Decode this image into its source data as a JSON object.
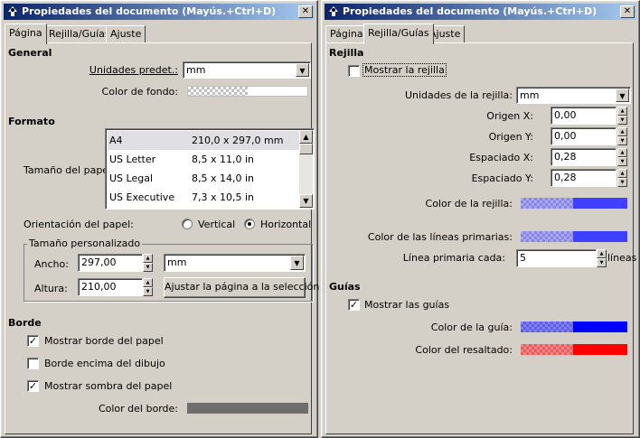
{
  "left": {
    "title": "Propiedades del documento (Mayús.+Ctrl+D)",
    "tabs": [
      "Página",
      "Rejilla/Guías",
      "Ajuste"
    ],
    "general": {
      "heading": "General",
      "units_label": "Unidades predet.:",
      "units_value": "mm",
      "bg_color_label": "Color de fondo:"
    },
    "format": {
      "heading": "Formato",
      "paper_size_label": "Tamaño del papel:",
      "paper_sizes": [
        {
          "name": "A4",
          "size": "210,0 x 297,0 mm"
        },
        {
          "name": "US Letter",
          "size": "8,5 x 11,0 in"
        },
        {
          "name": "US Legal",
          "size": "8,5 x 14,0 in"
        },
        {
          "name": "US Executive",
          "size": "7,3 x 10,5 in"
        }
      ],
      "orientation_label": "Orientación del papel:",
      "orientation_vertical": "Vertical",
      "orientation_horizontal": "Horizontal",
      "orientation_selected": "Horizontal",
      "custom_size_label": "Tamaño personalizado",
      "width_label": "Ancho:",
      "width_value": "297,00",
      "height_label": "Altura:",
      "height_value": "210,00",
      "custom_units": "mm",
      "fit_button": "Ajustar la página a la selección"
    },
    "border": {
      "heading": "Borde",
      "show_border": "Mostrar borde del papel",
      "show_border_checked": true,
      "border_on_top": "Borde encima del dibujo",
      "border_on_top_checked": false,
      "show_shadow": "Mostrar sombra del papel",
      "show_shadow_checked": true,
      "border_color_label": "Color del borde:"
    }
  },
  "right": {
    "title": "Propiedades del documento (Mayús.+Ctrl+D)",
    "tabs": [
      "Página",
      "Rejilla/Guías",
      "Ajuste"
    ],
    "grid": {
      "heading": "Rejilla",
      "show_grid": "Mostrar la rejilla",
      "show_grid_checked": false,
      "units_label": "Unidades de la rejilla:",
      "units_value": "mm",
      "origin_x_label": "Origen X:",
      "origin_x": "0,00",
      "origin_y_label": "Origen Y:",
      "origin_y": "0,00",
      "spacing_x_label": "Espaciado X:",
      "spacing_x": "0,28",
      "spacing_y_label": "Espaciado Y:",
      "spacing_y": "0,28",
      "grid_color_label": "Color de la rejilla:",
      "major_color_label": "Color de las líneas primarias:",
      "major_every_label": "Línea primaria cada:",
      "major_every_value": "5",
      "major_every_unit": "líneas"
    },
    "guides": {
      "heading": "Guías",
      "show_guides": "Mostrar las guías",
      "show_guides_checked": true,
      "guide_color_label": "Color de la guía:",
      "highlight_color_label": "Color del resaltado:"
    }
  },
  "colors": {
    "title_start": "#0a246a",
    "title_end": "#a6caf0",
    "grid_color": "#3f3fff",
    "major_color": "#3f3fff",
    "guide_color": "#0000ff",
    "highlight_color": "#ff0000",
    "border_color": "#6e6e6e"
  }
}
